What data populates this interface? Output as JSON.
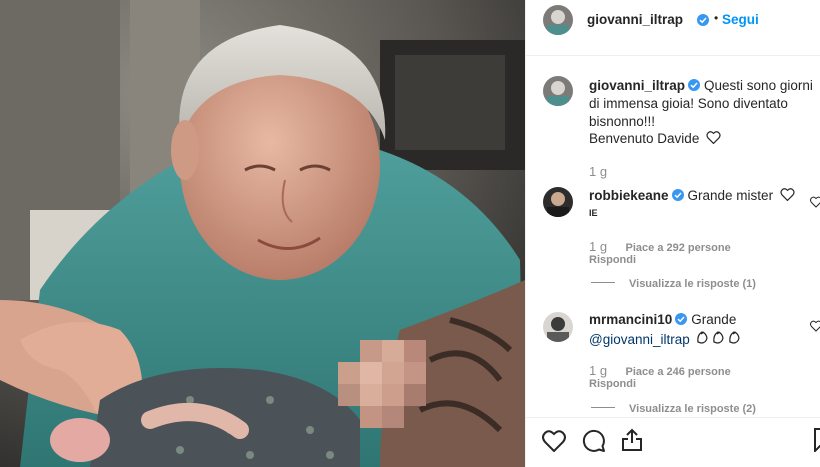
{
  "header": {
    "username": "giovanni_iltrap",
    "dot": "•",
    "follow_label": "Segui"
  },
  "caption": {
    "username": "giovanni_iltrap",
    "text": "Questi sono giorni di immensa gioia! Sono diventato bisnonno!!!",
    "line2": "Benvenuto Davide",
    "time": "1 g"
  },
  "comments": [
    {
      "username": "robbiekeane",
      "text": "Grande mister",
      "flag": "IE",
      "time": "1 g",
      "likes": "Piace a 292 persone",
      "reply": "Rispondi",
      "view_replies": "Visualizza le risposte (1)"
    },
    {
      "username": "mrmancini10",
      "text": "Grande",
      "mention": "@giovanni_iltrap",
      "time": "1 g",
      "likes": "Piace a 246 persone",
      "reply": "Rispondi",
      "view_replies": "Visualizza le risposte (2)"
    }
  ],
  "actions": {
    "like_icon": "heart-icon",
    "comment_icon": "comment-icon",
    "share_icon": "share-icon",
    "save_icon": "bookmark-icon"
  },
  "colors": {
    "link": "#0095f6",
    "verified": "#3897f0",
    "muted": "#8e8e8e"
  }
}
